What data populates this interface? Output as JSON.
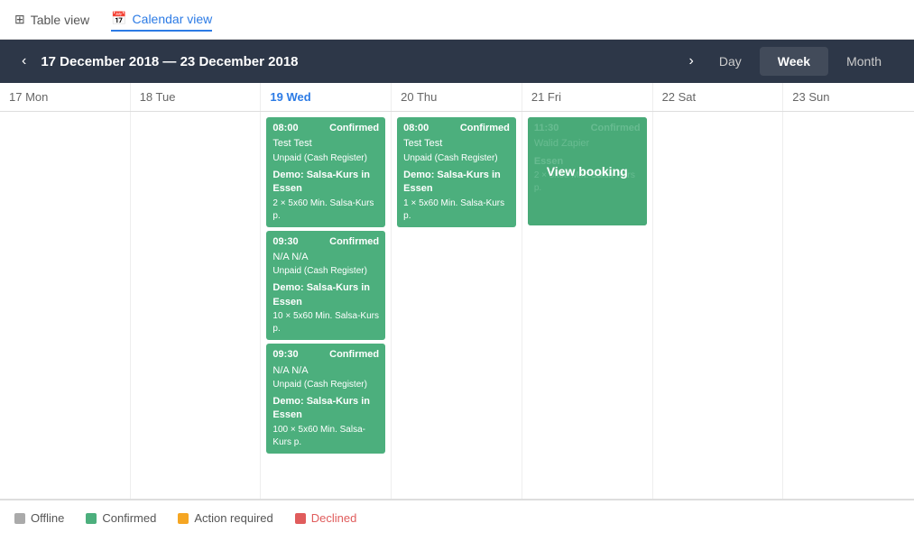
{
  "topnav": {
    "table_view": "Table view",
    "calendar_view": "Calendar view"
  },
  "calendar": {
    "date_range": "17 December 2018  —  23 December 2018",
    "views": [
      "Day",
      "Week",
      "Month"
    ],
    "active_view": "Week",
    "days": [
      {
        "label": "17 Mon",
        "id": "mon"
      },
      {
        "label": "18 Tue",
        "id": "tue"
      },
      {
        "label": "19 Wed",
        "id": "wed",
        "today": true
      },
      {
        "label": "20 Thu",
        "id": "thu"
      },
      {
        "label": "21 Fri",
        "id": "fri"
      },
      {
        "label": "22 Sat",
        "id": "sat"
      },
      {
        "label": "23 Sun",
        "id": "sun"
      }
    ],
    "bookings": {
      "wed": [
        {
          "time": "08:00",
          "status": "Confirmed",
          "name": "Test Test",
          "payment": "Unpaid (Cash Register)",
          "course": "Demo: Salsa-Kurs in Essen",
          "detail": "2 × 5x60 Min. Salsa-Kurs p.",
          "type": "confirmed"
        },
        {
          "time": "09:30",
          "status": "Confirmed",
          "name": "N/A N/A",
          "payment": "Unpaid (Cash Register)",
          "course": "Demo: Salsa-Kurs in Essen",
          "detail": "10 × 5x60 Min. Salsa-Kurs p.",
          "type": "confirmed"
        },
        {
          "time": "09:30",
          "status": "Confirmed",
          "name": "N/A N/A",
          "payment": "Unpaid (Cash Register)",
          "course": "Demo: Salsa-Kurs in Essen",
          "detail": "100 × 5x60 Min. Salsa-Kurs p.",
          "type": "confirmed"
        }
      ],
      "thu": [
        {
          "time": "08:00",
          "status": "Confirmed",
          "name": "Test Test",
          "payment": "Unpaid (Cash Register)",
          "course": "Demo: Salsa-Kurs in Essen",
          "detail": "1 × 5x60 Min. Salsa-Kurs p.",
          "type": "confirmed"
        }
      ],
      "fri": [
        {
          "time": "11:30",
          "status": "Confirmed",
          "name": "Walid Zapier",
          "payment": "",
          "course": "Essen",
          "detail": "2 × 5x60 Min. Salsa-Kurs p.",
          "type": "confirmed-dark",
          "has_overlay": true,
          "overlay_text": "View booking"
        }
      ]
    }
  },
  "legend": [
    {
      "id": "offline",
      "label": "Offline",
      "color_class": "dot-offline"
    },
    {
      "id": "confirmed",
      "label": "Confirmed",
      "color_class": "dot-confirmed"
    },
    {
      "id": "action",
      "label": "Action required",
      "color_class": "dot-action"
    },
    {
      "id": "declined",
      "label": "Declined",
      "color_class": "dot-declined"
    }
  ]
}
